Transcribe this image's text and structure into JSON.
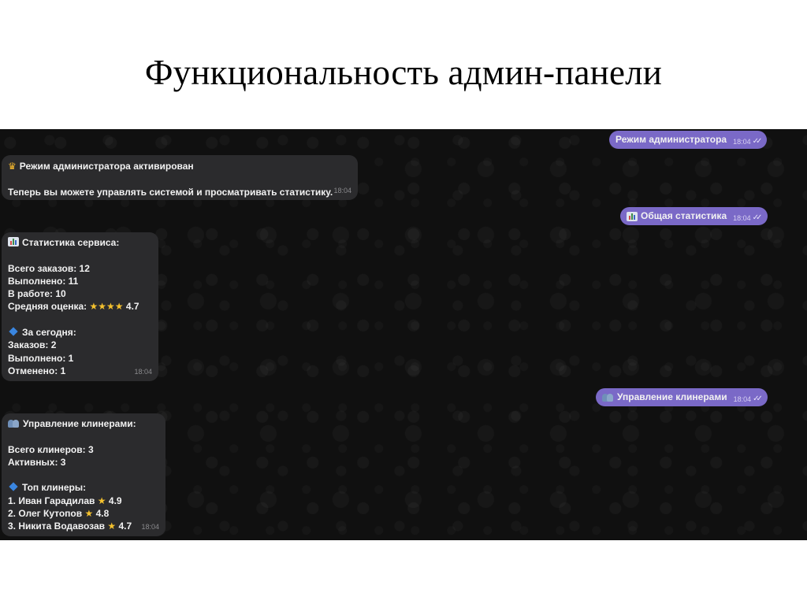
{
  "slide": {
    "title": "Функциональность админ-панели"
  },
  "chat": {
    "msg_admin_mode": {
      "text": "Режим администратора",
      "time": "18:04",
      "ticks": "✓✓"
    },
    "msg_activated": {
      "icon": "crown-icon",
      "header": "Режим администратора активирован",
      "body": "Теперь вы можете управлять системой и просматривать статистику.",
      "time": "18:04"
    },
    "msg_general_stats": {
      "icon": "bar-chart-icon",
      "text": "Общая статистика",
      "time": "18:04",
      "ticks": "✓✓"
    },
    "msg_service_stats": {
      "header": "Статистика сервиса:",
      "total_orders": "Всего заказов: 12",
      "completed": "Выполнено: 11",
      "in_progress": "В работе: 10",
      "avg_rating_label": "Средняя оценка:",
      "avg_rating_stars": "★★★★",
      "avg_rating_value": "4.7",
      "today_header": "За сегодня:",
      "today_orders": "Заказов: 2",
      "today_completed": "Выполнено: 1",
      "today_cancelled": "Отменено: 1",
      "time": "18:04"
    },
    "msg_manage_cleaners": {
      "icon": "people-icon",
      "text": "Управление клинерами",
      "time": "18:04",
      "ticks": "✓✓"
    },
    "msg_cleaners": {
      "header": "Управление клинерами:",
      "total": "Всего клинеров: 3",
      "active": "Активных: 3",
      "top_header": "Топ клинеры:",
      "top": [
        {
          "name": "1. Иван Гарадилав",
          "rating": "4.9"
        },
        {
          "name": "2. Олег Кутопов",
          "rating": "4.8"
        },
        {
          "name": "3. Никита Водавозав",
          "rating": "4.7"
        }
      ],
      "time": "18:04"
    }
  },
  "colors": {
    "outgoing_bubble": "#7a69c7",
    "incoming_bubble": "#2b2b2d",
    "chat_bg": "#101010",
    "star": "#f4c12e"
  }
}
